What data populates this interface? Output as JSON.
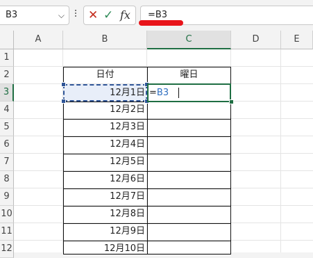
{
  "namebox": {
    "value": "B3"
  },
  "formula": {
    "value": "=B3"
  },
  "icons": {
    "cancel": "✕",
    "enter": "✓",
    "fx": "fx",
    "dropdown": "⌵"
  },
  "columns": [
    "A",
    "B",
    "C",
    "D",
    "E"
  ],
  "rows": [
    "1",
    "2",
    "3",
    "4",
    "5",
    "6",
    "7",
    "8",
    "9",
    "10",
    "11",
    "12"
  ],
  "table": {
    "header_date": "日付",
    "header_day": "曜日",
    "dates": [
      "12月1日",
      "12月2日",
      "12月3日",
      "12月4日",
      "12月5日",
      "12月6日",
      "12月7日",
      "12月8日",
      "12月9日",
      "12月10日"
    ]
  },
  "editing": {
    "eq": "=",
    "ref": "B3"
  },
  "colors": {
    "accent": "#1f6e43",
    "ref": "#2f6fc0",
    "highlight": "#e8141a"
  }
}
